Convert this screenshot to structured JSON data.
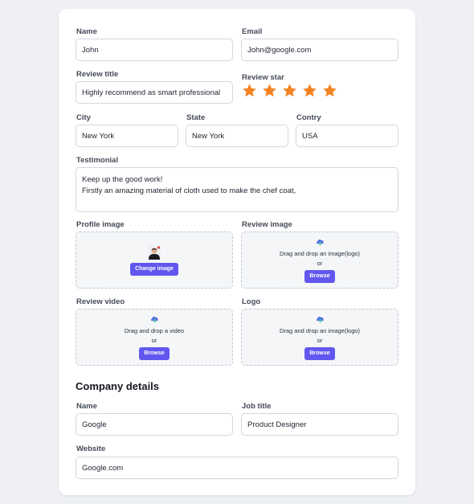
{
  "form": {
    "name": {
      "label": "Name",
      "value": "John"
    },
    "email": {
      "label": "Email",
      "value": "John@google.com"
    },
    "review_title": {
      "label": "Review title",
      "value": "Highly recommend as smart professional"
    },
    "review_star": {
      "label": "Review star",
      "rating": 5,
      "max": 5,
      "color": "#f58220"
    },
    "city": {
      "label": "City",
      "value": "New York"
    },
    "state": {
      "label": "State",
      "value": "New York"
    },
    "country": {
      "label": "Contry",
      "value": "USA"
    },
    "testimonial": {
      "label": "Testimonial",
      "line1": "Keep up the good work!",
      "line2": "Firstly an amazing material of cloth used to make the chef coat,"
    },
    "profile_image": {
      "label": "Profile image",
      "button": "Change image"
    },
    "review_image": {
      "label": "Review image",
      "prompt": "Drag and drop an image(logo)",
      "or": "or",
      "button": "Browse"
    },
    "review_video": {
      "label": "Review video",
      "prompt": "Drag and drop a video",
      "or": "or",
      "button": "Browse"
    },
    "logo": {
      "label": "Logo",
      "prompt": "Drag and drop an image(logo)",
      "or": "or",
      "button": "Browse"
    }
  },
  "company": {
    "title": "Company details",
    "name": {
      "label": "Name",
      "value": "Google"
    },
    "job_title": {
      "label": "Job title",
      "value": "Product Designer"
    },
    "website": {
      "label": "Website",
      "value": "Google.com"
    }
  },
  "colors": {
    "accent": "#6157ee",
    "star": "#f58220",
    "background": "#eef0f5"
  },
  "icons": {
    "upload": "upload-cloud-icon",
    "star": "star-icon",
    "avatar": "avatar-image"
  }
}
